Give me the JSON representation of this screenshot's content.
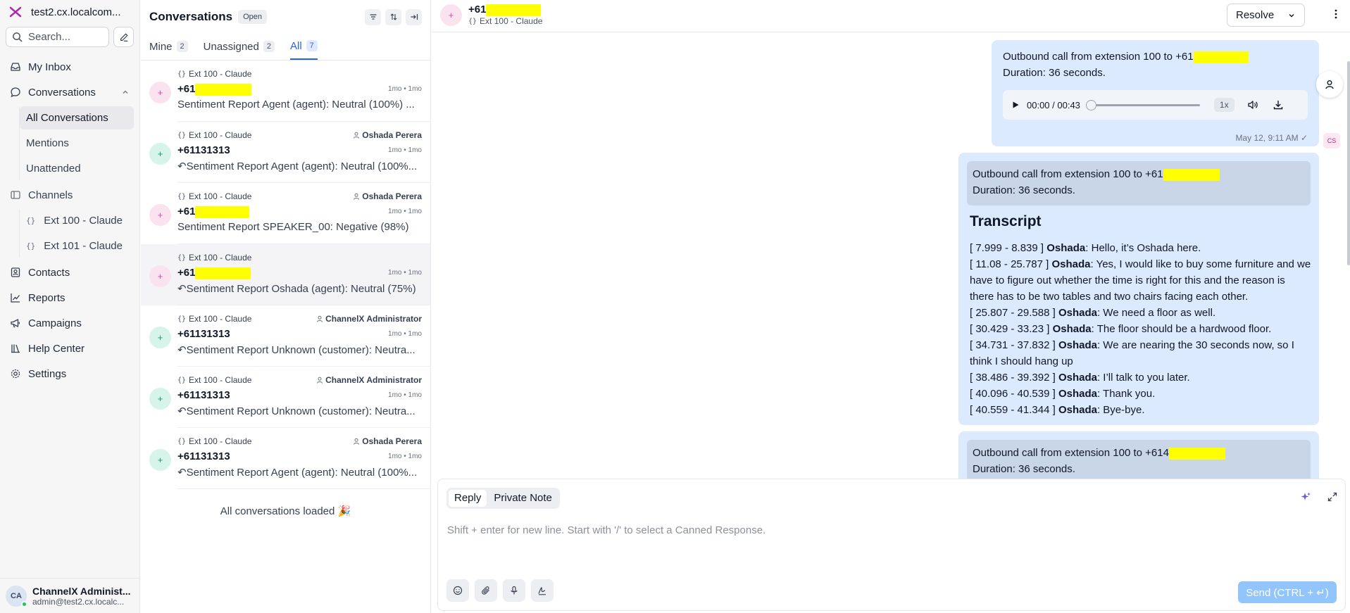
{
  "workspace": {
    "name": "test2.cx.localcom..."
  },
  "sidebar": {
    "search_placeholder": "Search...",
    "my_inbox": "My Inbox",
    "conversations": "Conversations",
    "conv_sub": [
      "All Conversations",
      "Mentions",
      "Unattended"
    ],
    "channels": "Channels",
    "channel_items": [
      "Ext 100 - Claude",
      "Ext 101 - Claude"
    ],
    "contacts": "Contacts",
    "reports": "Reports",
    "campaigns": "Campaigns",
    "help_center": "Help Center",
    "settings": "Settings"
  },
  "user": {
    "initials": "CA",
    "name": "ChannelX Administ...",
    "email": "admin@test2.cx.localc..."
  },
  "conv_list": {
    "title": "Conversations",
    "status": "Open",
    "tabs": [
      {
        "label": "Mine",
        "count": "2"
      },
      {
        "label": "Unassigned",
        "count": "2"
      },
      {
        "label": "All",
        "count": "7"
      }
    ],
    "items": [
      {
        "inbox": "Ext 100 - Claude",
        "agent": "",
        "name": "+61",
        "time": "1mo • 1mo",
        "message": "Sentiment Report Agent (agent): Neutral (100%) ..."
      },
      {
        "inbox": "Ext 100 - Claude",
        "agent": "Oshada Perera",
        "name": "+61131313",
        "time": "1mo • 1mo",
        "message": "Sentiment Report Agent (agent): Neutral (100%..."
      },
      {
        "inbox": "Ext 100 - Claude",
        "agent": "Oshada Perera",
        "name": "+61",
        "time": "1mo • 1mo",
        "message": "Sentiment Report SPEAKER_00: Negative (98%)"
      },
      {
        "inbox": "Ext 100 - Claude",
        "agent": "",
        "name": "+61",
        "time": "1mo • 1mo",
        "message": "Sentiment Report Oshada (agent): Neutral (75%)"
      },
      {
        "inbox": "Ext 100 - Claude",
        "agent": "ChannelX Administrator",
        "name": "+61131313",
        "time": "1mo • 1mo",
        "message": "Sentiment Report Unknown (customer): Neutra..."
      },
      {
        "inbox": "Ext 100 - Claude",
        "agent": "ChannelX Administrator",
        "name": "+61131313",
        "time": "1mo • 1mo",
        "message": "Sentiment Report Unknown (customer): Neutra..."
      },
      {
        "inbox": "Ext 100 - Claude",
        "agent": "Oshada Perera",
        "name": "+61131313",
        "time": "1mo • 1mo",
        "message": "Sentiment Report Agent (agent): Neutral (100%..."
      }
    ],
    "loaded_text": "All conversations loaded 🎉"
  },
  "header": {
    "name": "+61",
    "inbox": "Ext 100 - Claude",
    "resolve_label": "Resolve"
  },
  "messages": {
    "call_prefix": "Outbound call from extension 100 to +61",
    "call_prefix_b3": "Outbound call from extension 100 to +614",
    "duration": "Duration: 36 seconds.",
    "audio_time": "00:00 / 00:43",
    "audio_rate": "1x",
    "timestamp": "May 12, 9:11 AM",
    "transcript_title": "Transcript",
    "transcript": [
      {
        "range": "[ 7.999 - 8.839 ]",
        "speaker": "Oshada",
        "text": ": Hello, it’s Oshada here."
      },
      {
        "range": "[ 11.08 - 25.787 ]",
        "speaker": "Oshada",
        "text": ": Yes, I would like to buy some furniture and we have to figure out whether the time is right for this and the reason is there has to be two tables and two chairs facing each other."
      },
      {
        "range": "[ 25.807 - 29.588 ]",
        "speaker": "Oshada",
        "text": ": We need a floor as well."
      },
      {
        "range": "[ 30.429 - 33.23 ]",
        "speaker": "Oshada",
        "text": ": The floor should be a hardwood floor."
      },
      {
        "range": "[ 34.731 - 37.832 ]",
        "speaker": "Oshada",
        "text": ": We are nearing the 30 seconds now, so I think I should hang up"
      },
      {
        "range": "[ 38.486 - 39.392 ]",
        "speaker": "Oshada",
        "text": ": I’ll talk to you later."
      },
      {
        "range": "[ 40.096 - 40.539 ]",
        "speaker": "Oshada",
        "text": ": Thank you."
      },
      {
        "range": "[ 40.559 - 41.344 ]",
        "speaker": "Oshada",
        "text": ": Bye-bye."
      }
    ],
    "cs_badge": "CS"
  },
  "reply": {
    "tab_reply": "Reply",
    "tab_note": "Private Note",
    "placeholder": "Shift + enter for new line. Start with '/' to select a Canned Response.",
    "send_label": "Send (CTRL + ↵)"
  },
  "colors": {
    "accent": "#2563eb",
    "bubble": "#dbeafe",
    "redaction": "#ffff00"
  }
}
